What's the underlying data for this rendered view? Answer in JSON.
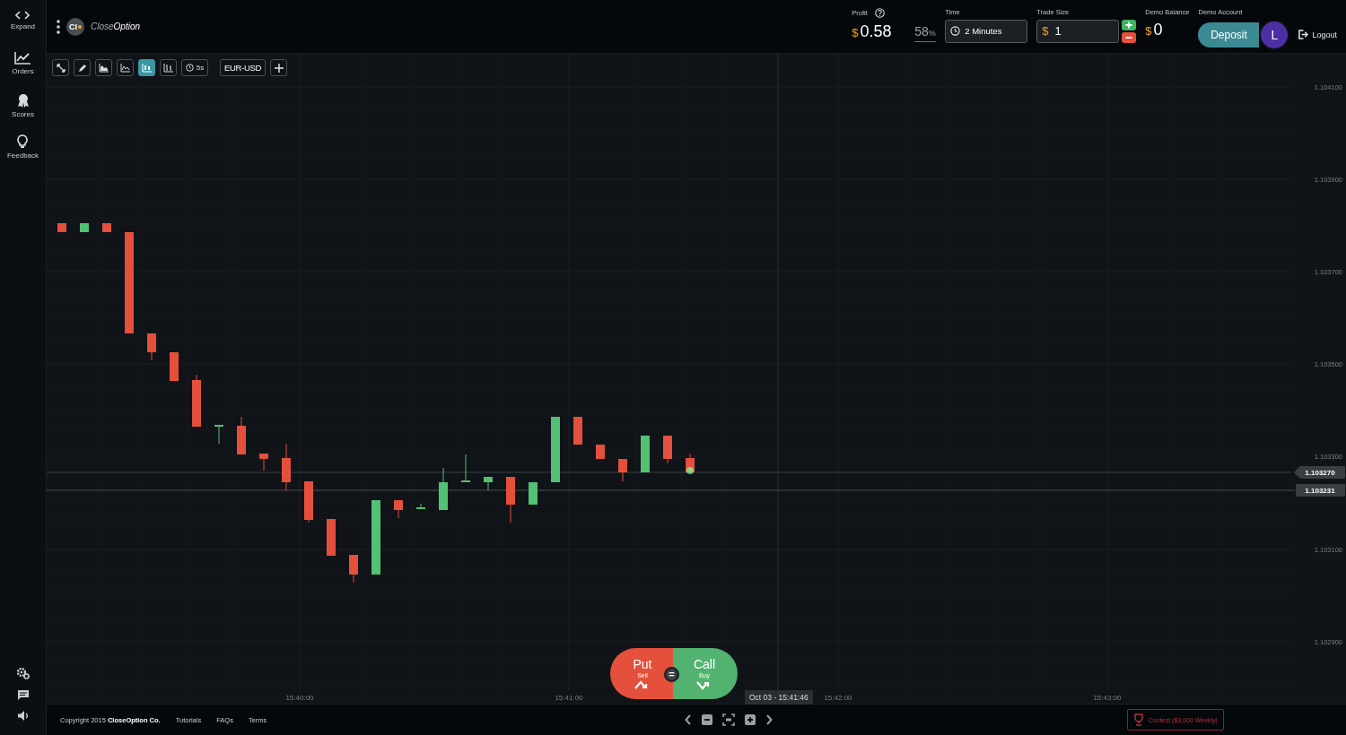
{
  "sidebar": {
    "items": [
      {
        "kind": "expand",
        "label": "Expand"
      },
      {
        "kind": "orders",
        "label": "Orders"
      },
      {
        "kind": "scores",
        "label": "Scores"
      },
      {
        "kind": "feedback",
        "label": "Feedback"
      }
    ]
  },
  "logo": {
    "badge": "CI",
    "plain": "Close",
    "accent": "Option"
  },
  "header": {
    "profit": {
      "label": "Profit",
      "currency": "$",
      "value": "0.58"
    },
    "payout": {
      "value": "58",
      "unit": "%"
    },
    "time": {
      "label": "Time",
      "value": "2 Minutes"
    },
    "trade_size": {
      "label": "Trade Size",
      "currency": "$",
      "value": "1"
    },
    "demo_balance": {
      "label": "Demo Balance",
      "currency": "$",
      "value": "0"
    },
    "account": {
      "label": "Demo Account",
      "deposit": "Deposit",
      "avatar": "L",
      "logout": "Logout"
    }
  },
  "toolbar": {
    "tools": [
      {
        "kind": "fullscreen",
        "selected": false
      },
      {
        "kind": "draw",
        "selected": false
      },
      {
        "kind": "area",
        "selected": false
      },
      {
        "kind": "line",
        "selected": false
      },
      {
        "kind": "candles",
        "selected": true
      },
      {
        "kind": "bars",
        "selected": false
      }
    ],
    "interval": "5s",
    "asset": "EUR-USD"
  },
  "chart": {
    "y_labels": [
      "1.104100",
      "1.103900",
      "1.103700",
      "1.103500",
      "1.103300",
      "1.103100",
      "1.102900"
    ],
    "x_labels": [
      "15:40:00",
      "15:41:00",
      "15:42:00",
      "15:43:00"
    ],
    "price_tags": [
      "1.103270",
      "1.103231"
    ],
    "cursor_time": "Oct 03 - 15:41:46"
  },
  "trade": {
    "put": {
      "label": "Put",
      "sub": "Sell"
    },
    "call": {
      "label": "Call",
      "sub": "Buy"
    },
    "middle": "="
  },
  "footer": {
    "copyright": "Copyright 2015 **CloseOption Co.**",
    "links": [
      "Tutorials",
      "FAQs",
      "Terms"
    ],
    "contest": "Contest ($3,000 Weekly)"
  }
}
